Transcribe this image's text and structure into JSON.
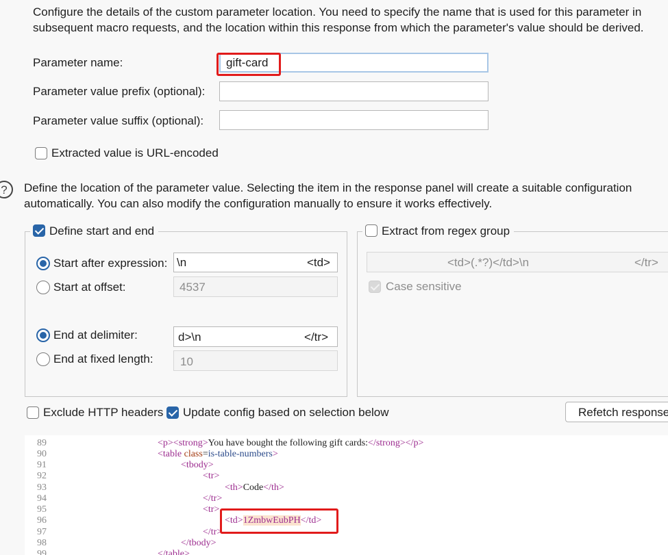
{
  "intro_text": "Configure the details of the custom parameter location. You need to specify the name that is used for this parameter in subsequent macro requests, and the location within this response from which the parameter's value should be derived.",
  "param_name": {
    "label": "Parameter name:",
    "value": "gift-card"
  },
  "prefix": {
    "label": "Parameter value prefix (optional):",
    "value": ""
  },
  "suffix": {
    "label": "Parameter value suffix (optional):",
    "value": ""
  },
  "url_encoded": {
    "label": "Extracted value is URL-encoded",
    "checked": false
  },
  "help_icon": "question-circle-icon",
  "location_text": "Define the location of the parameter value. Selecting the item in the response panel will create a suitable configuration automatically. You can also modify the configuration manually to ensure it works effectively.",
  "start_end": {
    "label": "Define start and end",
    "checked": true,
    "start_after": {
      "label": "Start after expression:",
      "selected": true,
      "value_left": "\\n",
      "value_right": "<td>"
    },
    "start_offset": {
      "label": "Start at offset:",
      "selected": false,
      "value": "4537"
    },
    "end_delim": {
      "label": "End at delimiter:",
      "selected": true,
      "value_left": "d>\\n",
      "value_right": "</tr>"
    },
    "end_fixed": {
      "label": "End at fixed length:",
      "selected": false,
      "value": "10"
    }
  },
  "regex": {
    "label": "Extract from regex group",
    "checked": false,
    "value_left": "<td>(.*?)</td>\\n",
    "value_right": "</tr>",
    "case_label": "Case sensitive",
    "case_checked": true
  },
  "exclude_headers": {
    "label": "Exclude HTTP headers",
    "checked": false
  },
  "update_config": {
    "label": "Update config based on selection below",
    "checked": true
  },
  "refetch_label": "Refetch response",
  "code": {
    "line_numbers": [
      "89",
      "90",
      "91",
      "92",
      "93",
      "94",
      "95",
      "96",
      "97",
      "98",
      "99"
    ],
    "l89": {
      "o1": "<p>",
      "o2": "<strong>",
      "text": "You have bought the following gift cards:",
      "c1": "</strong>",
      "c2": "</p>"
    },
    "l90": {
      "open": "<table ",
      "attr": "class",
      "eq": "=",
      "val": "is-table-numbers",
      "close": ">"
    },
    "l91": "<tbody>",
    "l92": "<tr>",
    "l93": {
      "o": "<th>",
      "text": "Code",
      "c": "</th>"
    },
    "l94": "</tr>",
    "l95": "<tr>",
    "l96": {
      "o": "<td>",
      "text": "1ZmbwEubPH",
      "c": "</td>"
    },
    "l97": "</tr>",
    "l98": "</tbody>",
    "l99": "</table>"
  }
}
